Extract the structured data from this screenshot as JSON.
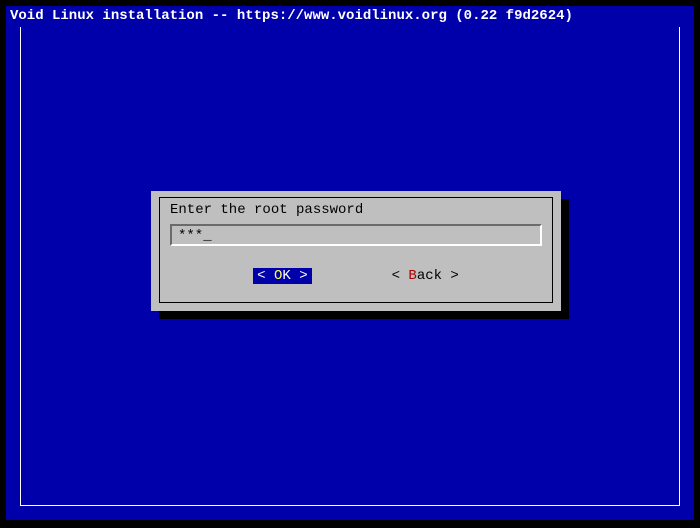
{
  "title": "Void Linux installation -- https://www.voidlinux.org (0.22 f9d2624)",
  "dialog": {
    "prompt": "Enter the root password",
    "input_value": "***",
    "cursor": "_"
  },
  "buttons": {
    "ok": {
      "left": "<",
      "spacer": "  ",
      "hotkey": "O",
      "rest": "K",
      "right": ">"
    },
    "back": {
      "left": "<",
      "spacer": " ",
      "hotkey": "B",
      "rest": "ack",
      "right": " >"
    }
  }
}
